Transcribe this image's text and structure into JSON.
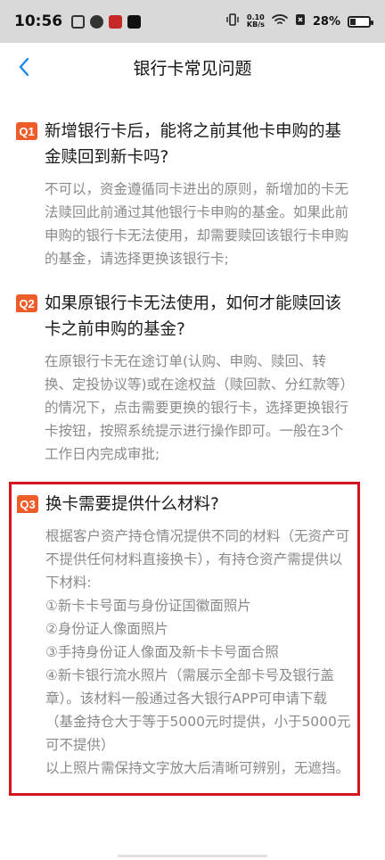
{
  "status_bar": {
    "time": "10:56",
    "network_speed_value": "0.10",
    "network_speed_unit": "KB/s",
    "battery": "28%"
  },
  "nav": {
    "back_icon": "chevron-left-icon",
    "title": "银行卡常见问题"
  },
  "colors": {
    "badge": "#ee5c29",
    "back_icon": "#1e88e5",
    "highlight_border": "#d6141e"
  },
  "faq": [
    {
      "badge": "Q1",
      "question": "新增银行卡后，能将之前其他卡申购的基金赎回到新卡吗?",
      "answer": "不可以，资金遵循同卡进出的原则，新增加的卡无法赎回此前通过其他银行卡申购的基金。如果此前申购的银行卡无法使用，却需要赎回该银行卡申购的基金，请选择更换该银行卡;"
    },
    {
      "badge": "Q2",
      "question": "如果原银行卡无法使用，如何才能赎回该卡之前申购的基金?",
      "answer": "在原银行卡无在途订单(认购、申购、赎回、转换、定投协议等)或在途权益（赎回款、分红款等）的情况下，点击需要更换的银行卡，选择更换银行卡按钮，按照系统提示进行操作即可。一般在3个工作日内完成审批;"
    },
    {
      "badge": "Q3",
      "question": "换卡需要提供什么材料?",
      "answer": "根据客户资产持仓情况提供不同的材料（无资产可不提供任何材料直接换卡），有持仓资产需提供以下材料:\n①新卡卡号面与身份证国徽面照片\n②身份证人像面照片\n③手持身份证人像面及新卡卡号面合照\n④新卡银行流水照片（需展示全部卡号及银行盖章）。该材料一般通过各大银行APP可申请下载（基金持仓大于等于5000元时提供，小于5000元可不提供）\n以上照片需保持文字放大后清晰可辨别，无遮挡。"
    }
  ]
}
